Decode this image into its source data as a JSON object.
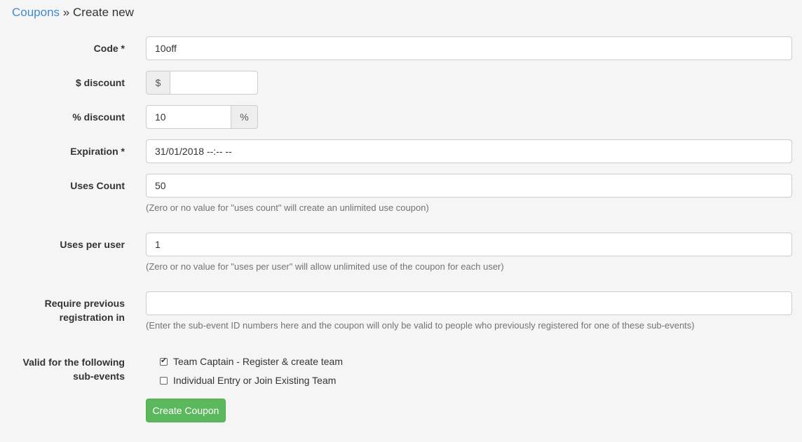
{
  "breadcrumb": {
    "parent": "Coupons",
    "separator": "»",
    "current": "Create new"
  },
  "fields": {
    "code": {
      "label": "Code *",
      "value": "10off"
    },
    "dollar_discount": {
      "label": "$ discount",
      "prefix": "$",
      "value": ""
    },
    "percent_discount": {
      "label": "% discount",
      "value": "10",
      "suffix": "%"
    },
    "expiration": {
      "label": "Expiration *",
      "value": "31/01/2018 --:-- --"
    },
    "uses_count": {
      "label": "Uses Count",
      "value": "50",
      "help": "(Zero or no value for \"uses count\" will create an unlimited use coupon)"
    },
    "uses_per_user": {
      "label": "Uses per user",
      "value": "1",
      "help": "(Zero or no value for \"uses per user\" will allow unlimited use of the coupon for each user)"
    },
    "require_previous": {
      "label_line1": "Require previous",
      "label_line2": "registration in",
      "value": "",
      "help": "(Enter the sub-event ID numbers here and the coupon will only be valid to people who previously registered for one of these sub-events)"
    }
  },
  "sub_events": {
    "label_line1": "Valid for the following",
    "label_line2": "sub-events",
    "options": [
      {
        "label": "Team Captain - Register & create team",
        "checked": true
      },
      {
        "label": "Individual Entry or Join Existing Team",
        "checked": false
      }
    ]
  },
  "submit_label": "Create Coupon"
}
